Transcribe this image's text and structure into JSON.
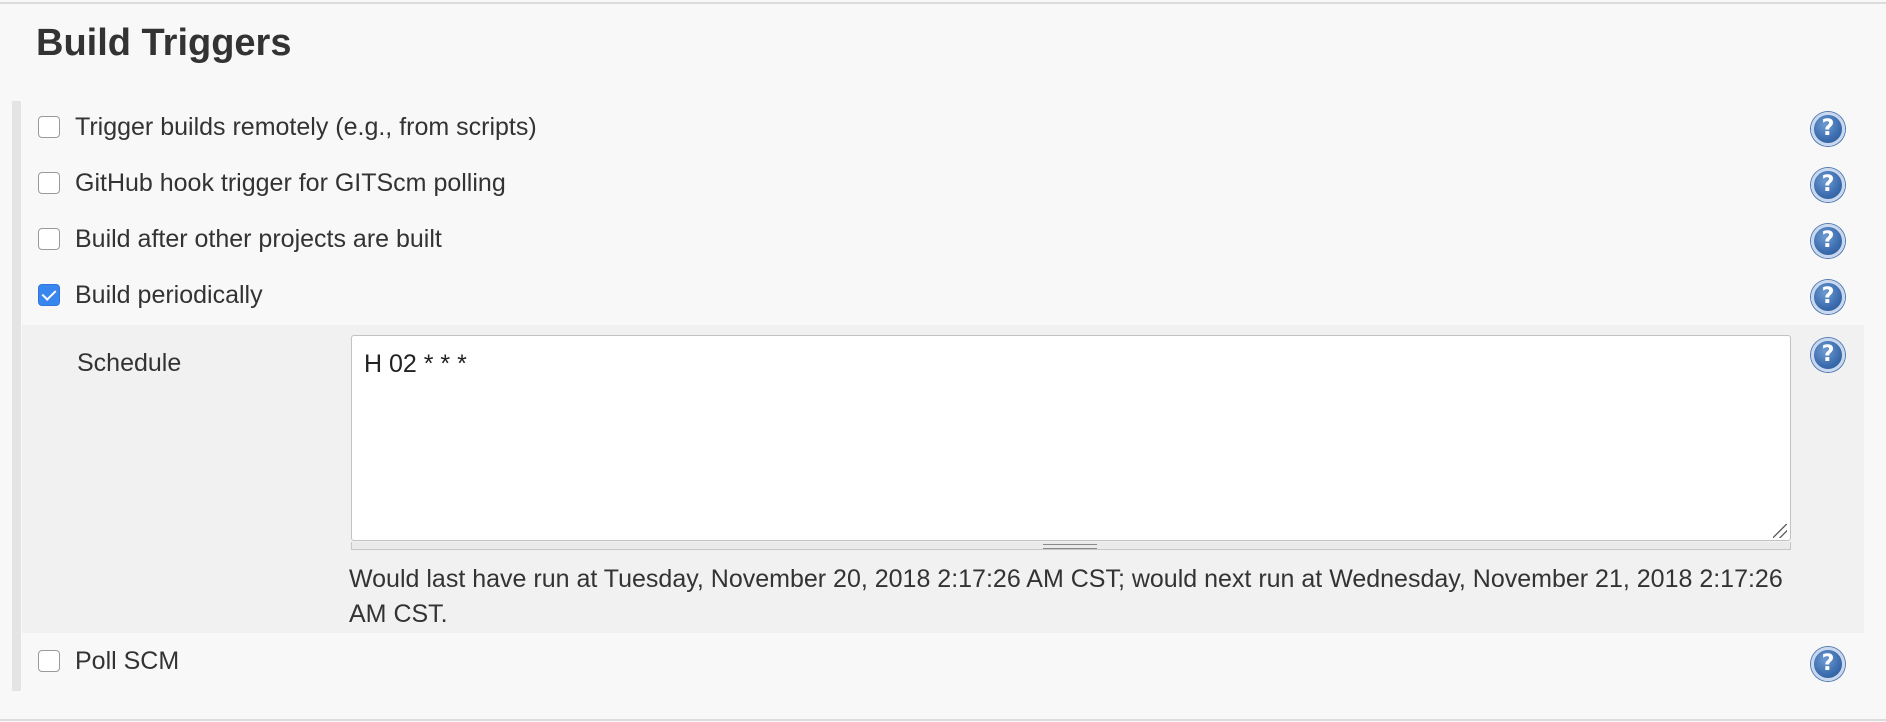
{
  "section": {
    "title": "Build Triggers"
  },
  "triggers": [
    {
      "label": "Trigger builds remotely (e.g., from scripts)",
      "checked": false,
      "help_icon": "help-icon"
    },
    {
      "label": "GitHub hook trigger for GITScm polling",
      "checked": false,
      "help_icon": "help-icon"
    },
    {
      "label": "Build after other projects are built",
      "checked": false,
      "help_icon": "help-icon"
    },
    {
      "label": "Build periodically",
      "checked": true,
      "help_icon": "help-icon"
    },
    {
      "label": "Poll SCM",
      "checked": false,
      "help_icon": "help-icon"
    }
  ],
  "schedule": {
    "label": "Schedule",
    "value": "H 02 * * *",
    "info": "Would last have run at Tuesday, November 20, 2018 2:17:26 AM CST; would next run at Wednesday, November 21, 2018 2:17:26 AM CST.",
    "help_icon": "help-icon"
  },
  "help_glyph": "?",
  "colors": {
    "checkbox_checked": "#3a86ef",
    "help_icon": "#3b6cae",
    "panel_background": "#f1f1f1",
    "page_background": "#f8f8f8"
  }
}
